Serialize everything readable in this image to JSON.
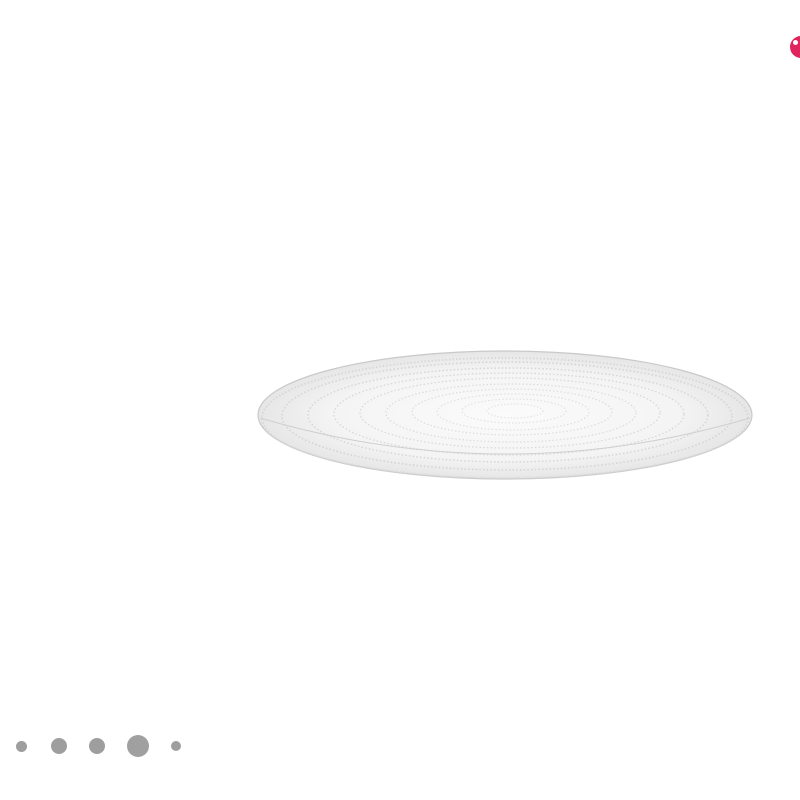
{
  "product_image": {
    "icon": "glass-plate-image"
  },
  "corner_badge": {
    "icon": "heart-badge-icon",
    "color": "#e0245e"
  },
  "carousel": {
    "dot_count": 5,
    "active_index": 3,
    "dot_color": "#9e9e9e"
  }
}
